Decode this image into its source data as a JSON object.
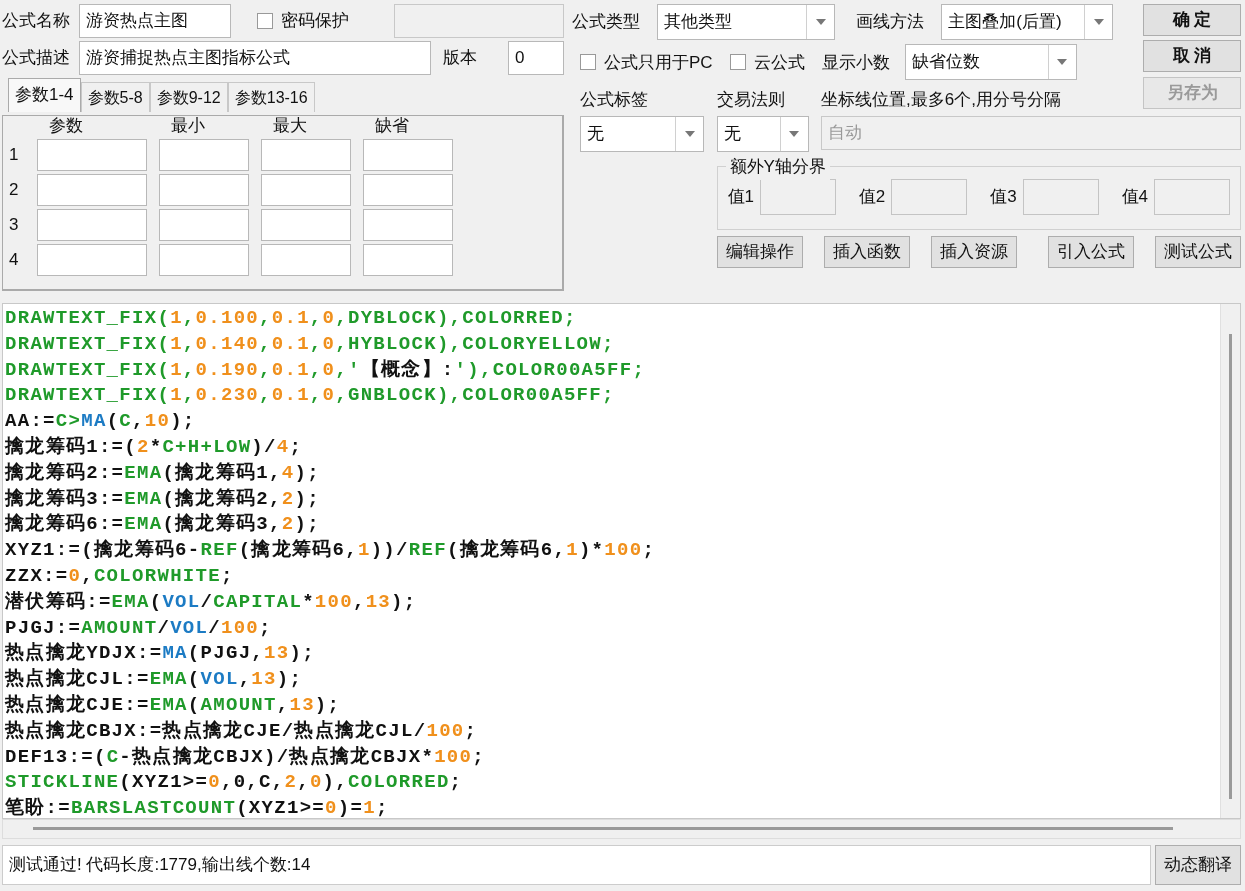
{
  "formula": {
    "name_label": "公式名称",
    "name_value": "游资热点主图",
    "password": {
      "label": "密码保护",
      "checked": false
    },
    "password_field": {
      "disabled": true
    },
    "desc_label": "公式描述",
    "desc_value": "游资捕捉热点主图指标公式",
    "version_label": "版本",
    "version_value": "0"
  },
  "param_tabs": [
    {
      "label": "参数1-4",
      "selected": true
    },
    {
      "label": "参数5-8",
      "selected": false
    },
    {
      "label": "参数9-12",
      "selected": false
    },
    {
      "label": "参数13-16",
      "selected": false
    }
  ],
  "param_table": {
    "columns": [
      "参数",
      "最小",
      "最大",
      "缺省"
    ],
    "rows": [
      "1",
      "2",
      "3",
      "4"
    ]
  },
  "type": {
    "label": "公式类型",
    "value": "其他类型"
  },
  "draw_method": {
    "label": "画线方法",
    "value": "主图叠加(后置)"
  },
  "options": [
    {
      "label": "公式只用于PC",
      "checked": false
    },
    {
      "label": "云公式",
      "checked": false
    }
  ],
  "decimals": {
    "label": "显示小数",
    "value": "缺省位数"
  },
  "side_buttons": [
    {
      "label": "确 定",
      "disabled": false
    },
    {
      "label": "取 消",
      "disabled": false
    },
    {
      "label": "另存为",
      "disabled": true
    }
  ],
  "tag": {
    "label": "公式标签",
    "value": "无"
  },
  "trade_rule": {
    "label": "交易法则",
    "value": "无"
  },
  "axis_lines": {
    "label": "坐标线位置,最多6个,用分号分隔",
    "value": "自动",
    "disabled": true
  },
  "y_bounds": {
    "title": "额外Y轴分界",
    "fields": [
      {
        "label": "值1",
        "disabled": true
      },
      {
        "label": "值2",
        "disabled": true
      },
      {
        "label": "值3",
        "disabled": true
      },
      {
        "label": "值4",
        "disabled": true
      }
    ]
  },
  "tool_buttons": [
    "编辑操作",
    "插入函数",
    "插入资源",
    "引入公式",
    "测试公式"
  ],
  "code_lines": [
    [
      {
        "t": "DRAWTEXT_FIX(",
        "kind": "function"
      },
      {
        "t": "1",
        "kind": "number"
      },
      {
        "t": ",",
        "kind": "function"
      },
      {
        "t": "0.100",
        "kind": "number"
      },
      {
        "t": ",",
        "kind": "function"
      },
      {
        "t": "0.1",
        "kind": "number"
      },
      {
        "t": ",",
        "kind": "function"
      },
      {
        "t": "0",
        "kind": "number"
      },
      {
        "t": ",DYBLOCK),COLORRED;",
        "kind": "function"
      }
    ],
    [
      {
        "t": "DRAWTEXT_FIX(",
        "kind": "function"
      },
      {
        "t": "1",
        "kind": "number"
      },
      {
        "t": ",",
        "kind": "function"
      },
      {
        "t": "0.140",
        "kind": "number"
      },
      {
        "t": ",",
        "kind": "function"
      },
      {
        "t": "0.1",
        "kind": "number"
      },
      {
        "t": ",",
        "kind": "function"
      },
      {
        "t": "0",
        "kind": "number"
      },
      {
        "t": ",HYBLOCK),COLORYELLOW;",
        "kind": "function"
      }
    ],
    [
      {
        "t": "DRAWTEXT_FIX(",
        "kind": "function"
      },
      {
        "t": "1",
        "kind": "number"
      },
      {
        "t": ",",
        "kind": "function"
      },
      {
        "t": "0.190",
        "kind": "number"
      },
      {
        "t": ",",
        "kind": "function"
      },
      {
        "t": "0.1",
        "kind": "number"
      },
      {
        "t": ",",
        "kind": "function"
      },
      {
        "t": "0",
        "kind": "number"
      },
      {
        "t": ",'",
        "kind": "function"
      },
      {
        "t": "【概念】:",
        "kind": "plain"
      },
      {
        "t": "'),COLOR00A5FF;",
        "kind": "function"
      }
    ],
    [
      {
        "t": "DRAWTEXT_FIX(",
        "kind": "function"
      },
      {
        "t": "1",
        "kind": "number"
      },
      {
        "t": ",",
        "kind": "function"
      },
      {
        "t": "0.230",
        "kind": "number"
      },
      {
        "t": ",",
        "kind": "function"
      },
      {
        "t": "0.1",
        "kind": "number"
      },
      {
        "t": ",",
        "kind": "function"
      },
      {
        "t": "0",
        "kind": "number"
      },
      {
        "t": ",GNBLOCK),COLOR00A5FF;",
        "kind": "function"
      }
    ],
    [
      {
        "t": "AA:=",
        "kind": "plain"
      },
      {
        "t": "C>",
        "kind": "function"
      },
      {
        "t": "MA",
        "kind": "series"
      },
      {
        "t": "(",
        "kind": "plain"
      },
      {
        "t": "C",
        "kind": "function"
      },
      {
        "t": ",",
        "kind": "plain"
      },
      {
        "t": "10",
        "kind": "number"
      },
      {
        "t": ");",
        "kind": "plain"
      }
    ],
    [
      {
        "t": "擒龙筹码1:=(",
        "kind": "plain"
      },
      {
        "t": "2",
        "kind": "number"
      },
      {
        "t": "*",
        "kind": "plain"
      },
      {
        "t": "C+H+LOW",
        "kind": "function"
      },
      {
        "t": ")/",
        "kind": "plain"
      },
      {
        "t": "4",
        "kind": "number"
      },
      {
        "t": ";",
        "kind": "plain"
      }
    ],
    [
      {
        "t": "擒龙筹码2:=",
        "kind": "plain"
      },
      {
        "t": "EMA",
        "kind": "function"
      },
      {
        "t": "(擒龙筹码1,",
        "kind": "plain"
      },
      {
        "t": "4",
        "kind": "number"
      },
      {
        "t": ");",
        "kind": "plain"
      }
    ],
    [
      {
        "t": "擒龙筹码3:=",
        "kind": "plain"
      },
      {
        "t": "EMA",
        "kind": "function"
      },
      {
        "t": "(擒龙筹码2,",
        "kind": "plain"
      },
      {
        "t": "2",
        "kind": "number"
      },
      {
        "t": ");",
        "kind": "plain"
      }
    ],
    [
      {
        "t": "擒龙筹码6:=",
        "kind": "plain"
      },
      {
        "t": "EMA",
        "kind": "function"
      },
      {
        "t": "(擒龙筹码3,",
        "kind": "plain"
      },
      {
        "t": "2",
        "kind": "number"
      },
      {
        "t": ");",
        "kind": "plain"
      }
    ],
    [
      {
        "t": "XYZ1:=(擒龙筹码6-",
        "kind": "plain"
      },
      {
        "t": "REF",
        "kind": "function"
      },
      {
        "t": "(擒龙筹码6,",
        "kind": "plain"
      },
      {
        "t": "1",
        "kind": "number"
      },
      {
        "t": "))/",
        "kind": "plain"
      },
      {
        "t": "REF",
        "kind": "function"
      },
      {
        "t": "(擒龙筹码6,",
        "kind": "plain"
      },
      {
        "t": "1",
        "kind": "number"
      },
      {
        "t": ")*",
        "kind": "plain"
      },
      {
        "t": "100",
        "kind": "number"
      },
      {
        "t": ";",
        "kind": "plain"
      }
    ],
    [
      {
        "t": "ZZX:=",
        "kind": "plain"
      },
      {
        "t": "0",
        "kind": "number"
      },
      {
        "t": ",",
        "kind": "plain"
      },
      {
        "t": "COLORWHITE",
        "kind": "function"
      },
      {
        "t": ";",
        "kind": "plain"
      }
    ],
    [
      {
        "t": "潜伏筹码:=",
        "kind": "plain"
      },
      {
        "t": "EMA",
        "kind": "function"
      },
      {
        "t": "(",
        "kind": "plain"
      },
      {
        "t": "VOL",
        "kind": "series"
      },
      {
        "t": "/",
        "kind": "plain"
      },
      {
        "t": "CAPITAL",
        "kind": "function"
      },
      {
        "t": "*",
        "kind": "plain"
      },
      {
        "t": "100",
        "kind": "number"
      },
      {
        "t": ",",
        "kind": "plain"
      },
      {
        "t": "13",
        "kind": "number"
      },
      {
        "t": ");",
        "kind": "plain"
      }
    ],
    [
      {
        "t": "PJGJ:=",
        "kind": "plain"
      },
      {
        "t": "AMOUNT",
        "kind": "function"
      },
      {
        "t": "/",
        "kind": "plain"
      },
      {
        "t": "VOL",
        "kind": "series"
      },
      {
        "t": "/",
        "kind": "plain"
      },
      {
        "t": "100",
        "kind": "number"
      },
      {
        "t": ";",
        "kind": "plain"
      }
    ],
    [
      {
        "t": "热点擒龙YDJX:=",
        "kind": "plain"
      },
      {
        "t": "MA",
        "kind": "series"
      },
      {
        "t": "(PJGJ,",
        "kind": "plain"
      },
      {
        "t": "13",
        "kind": "number"
      },
      {
        "t": ");",
        "kind": "plain"
      }
    ],
    [
      {
        "t": "热点擒龙CJL:=",
        "kind": "plain"
      },
      {
        "t": "EMA",
        "kind": "function"
      },
      {
        "t": "(",
        "kind": "plain"
      },
      {
        "t": "VOL",
        "kind": "series"
      },
      {
        "t": ",",
        "kind": "plain"
      },
      {
        "t": "13",
        "kind": "number"
      },
      {
        "t": ");",
        "kind": "plain"
      }
    ],
    [
      {
        "t": "热点擒龙CJE:=",
        "kind": "plain"
      },
      {
        "t": "EMA",
        "kind": "function"
      },
      {
        "t": "(",
        "kind": "plain"
      },
      {
        "t": "AMOUNT",
        "kind": "function"
      },
      {
        "t": ",",
        "kind": "plain"
      },
      {
        "t": "13",
        "kind": "number"
      },
      {
        "t": ");",
        "kind": "plain"
      }
    ],
    [
      {
        "t": "热点擒龙CBJX:=热点擒龙CJE/热点擒龙CJL/",
        "kind": "plain"
      },
      {
        "t": "100",
        "kind": "number"
      },
      {
        "t": ";",
        "kind": "plain"
      }
    ],
    [
      {
        "t": "DEF13:=(",
        "kind": "plain"
      },
      {
        "t": "C",
        "kind": "function"
      },
      {
        "t": "-热点擒龙CBJX)/热点擒龙CBJX*",
        "kind": "plain"
      },
      {
        "t": "100",
        "kind": "number"
      },
      {
        "t": ";",
        "kind": "plain"
      }
    ],
    [
      {
        "t": "STICKLINE",
        "kind": "function"
      },
      {
        "t": "(XYZ1>=",
        "kind": "plain"
      },
      {
        "t": "0",
        "kind": "number"
      },
      {
        "t": ",0,C,",
        "kind": "plain"
      },
      {
        "t": "2",
        "kind": "number"
      },
      {
        "t": ",",
        "kind": "plain"
      },
      {
        "t": "0",
        "kind": "number"
      },
      {
        "t": "),",
        "kind": "plain"
      },
      {
        "t": "COLORRED",
        "kind": "function"
      },
      {
        "t": ";",
        "kind": "plain"
      }
    ],
    [
      {
        "t": "笔盼:=",
        "kind": "plain"
      },
      {
        "t": "BARSLASTCOUNT",
        "kind": "function"
      },
      {
        "t": "(XYZ1>=",
        "kind": "plain"
      },
      {
        "t": "0",
        "kind": "number"
      },
      {
        "t": ")=",
        "kind": "plain"
      },
      {
        "t": "1",
        "kind": "number"
      },
      {
        "t": ";",
        "kind": "plain"
      }
    ]
  ],
  "status": {
    "message": "测试通过! 代码长度:1779,输出线个数:14",
    "button": "动态翻译"
  }
}
